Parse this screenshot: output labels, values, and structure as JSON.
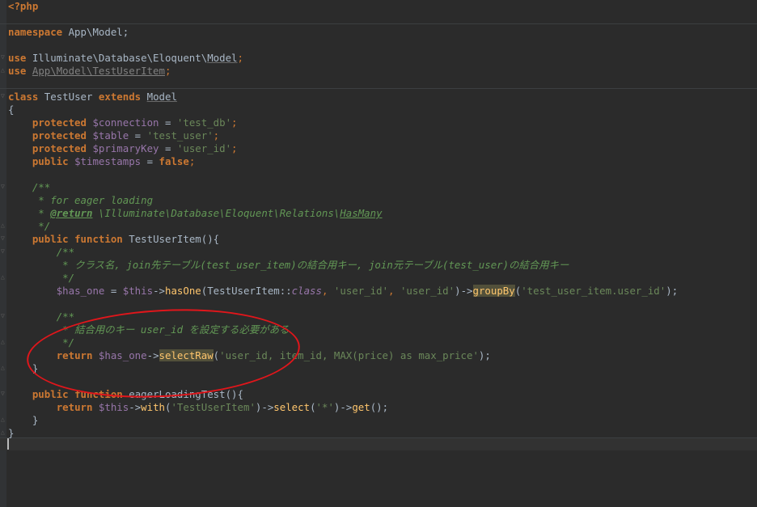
{
  "code": {
    "l01_open": "<?php",
    "l03_ns_kw": "namespace",
    "l03_ns": " App\\Model;",
    "l05_use_kw": "use",
    "l05_ns": " Illuminate\\Database\\Eloquent\\",
    "l05_cls": "Model",
    "l05_end": ";",
    "l06_use_kw": "use",
    "l06_ns": "App\\Model\\TestUserItem",
    "l06_end": ";",
    "l08_class_kw": "class",
    "l08_name": " TestUser ",
    "l08_ext_kw": "extends",
    "l08_parent": "Model",
    "l09": "{",
    "l10_kw": "protected",
    "l10_var": "$connection",
    "l10_eq": " = ",
    "l10_str": "'test_db'",
    "l10_end": ";",
    "l11_kw": "protected",
    "l11_var": "$table",
    "l11_eq": " = ",
    "l11_str": "'test_user'",
    "l11_end": ";",
    "l12_kw": "protected",
    "l12_var": "$primaryKey",
    "l12_eq": " = ",
    "l12_str": "'user_id'",
    "l12_end": ";",
    "l13_kw": "public",
    "l13_var": "$timestamps",
    "l13_eq": " = ",
    "l13_val": "false",
    "l13_end": ";",
    "l15": "/**",
    "l16": " * for eager loading",
    "l17_star": " * ",
    "l17_tag": "@return",
    "l17_path": " \\Illuminate\\Database\\Eloquent\\Relations\\",
    "l17_ref": "HasMany",
    "l18": " */",
    "l19_kw1": "public",
    "l19_kw2": "function",
    "l19_fn": "TestUserItem",
    "l19_rest": "(){",
    "l20": "/**",
    "l21": " * クラス名, join先テーブル(test_user_item)の結合用キー, join元テーブル(test_user)の結合用キー",
    "l22": " */",
    "l23_var": "$has_one",
    "l23_eq": " = ",
    "l23_this": "$this",
    "l23_arrow": "->",
    "l23_fn": "hasOne",
    "l23_p1": "(TestUserItem::",
    "l23_class": "class",
    "l23_c1": ", ",
    "l23_s1": "'user_id'",
    "l23_c2": ", ",
    "l23_s2": "'user_id'",
    "l23_p2": ")->",
    "l23_fn2": "groupBy",
    "l23_p3": "(",
    "l23_s3": "'test_user_item.user_id'",
    "l23_p4": ");",
    "l25": "/**",
    "l26": " * 結合用のキー user_id を設定する必要がある",
    "l27": " */",
    "l28_kw": "return",
    "l28_var": "$has_one",
    "l28_arrow": "->",
    "l28_fn": "selectRaw",
    "l28_p1": "(",
    "l28_str": "'user_id, item_id, MAX(price) as max_price'",
    "l28_p2": ");",
    "l29": "}",
    "l31_kw1": "public",
    "l31_kw2": "function",
    "l31_fn": "eagerLoadingTest",
    "l31_rest": "(){",
    "l32_kw": "return",
    "l32_this": "$this",
    "l32_arrow": "->",
    "l32_fn": "with",
    "l32_p1": "(",
    "l32_s1": "'TestUserItem'",
    "l32_p2": ")->",
    "l32_fn2": "select",
    "l32_p3": "(",
    "l32_s2": "'*'",
    "l32_p4": ")->",
    "l32_fn3": "get",
    "l32_p5": "();",
    "l33": "}",
    "l34": "}"
  },
  "colors": {
    "background": "#2b2b2b",
    "keyword": "#cc7832",
    "variable": "#9876aa",
    "string": "#6a8759",
    "comment": "#629755",
    "function": "#ffc66d",
    "annotation_circle": "#e0161b"
  }
}
